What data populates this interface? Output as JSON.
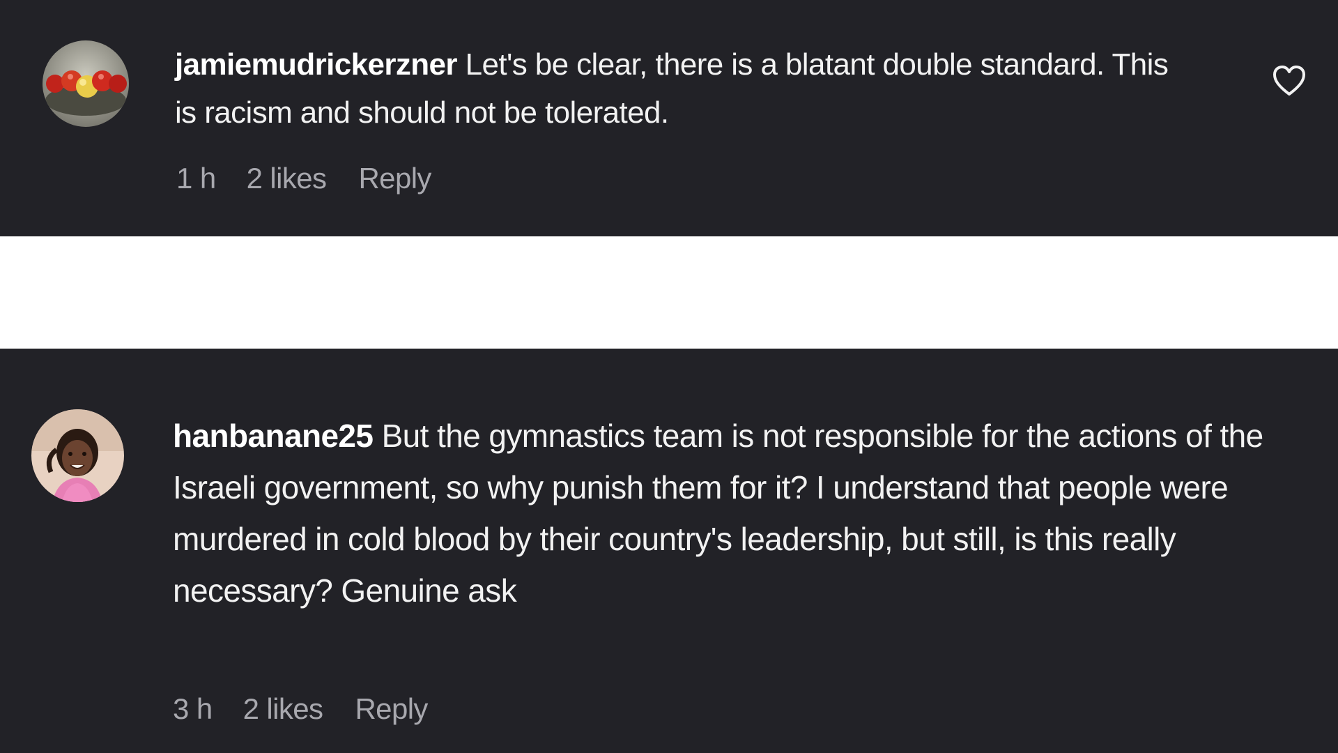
{
  "comments": [
    {
      "username": "jamiemudrickerzner",
      "text": "Let's be clear, there is a blatant double standard. This is racism and should not be tolerated.",
      "time": "1 h",
      "likes": "2 likes",
      "reply_label": "Reply",
      "avatar_icon": "avatar-apples-image",
      "like_icon": "heart-outline-icon"
    },
    {
      "username": "hanbanane25",
      "text": "But the gymnastics team is not responsible for the actions of the Israeli government, so why punish them for it? I understand that people were murdered in cold blood by their country's leadership, but still, is this really necessary? Genuine ask",
      "time": "3 h",
      "likes": "2 likes",
      "reply_label": "Reply",
      "avatar_icon": "avatar-person-image"
    }
  ],
  "colors": {
    "panel_background": "#222227",
    "gap_background": "#ffffff",
    "text_primary": "#f2f2f2",
    "text_secondary": "#a8a8ae"
  }
}
